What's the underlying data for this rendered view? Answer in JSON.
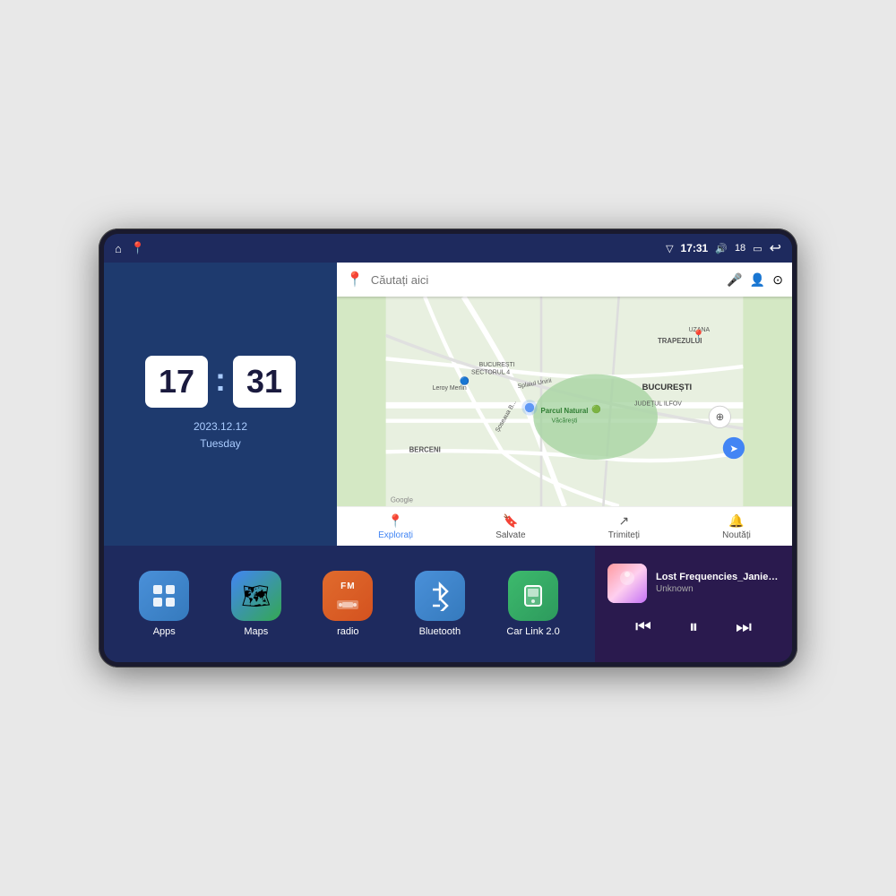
{
  "device": {
    "status_bar": {
      "left_icons": [
        "home",
        "maps-pin"
      ],
      "time": "17:31",
      "signal_icon": "▽",
      "volume_icon": "🔊",
      "battery_level": "18",
      "battery_icon": "▭",
      "back_icon": "↩"
    },
    "clock": {
      "hours": "17",
      "minutes": "31",
      "date": "2023.12.12",
      "day": "Tuesday"
    },
    "map": {
      "search_placeholder": "Căutați aici",
      "locations": [
        "Parcul Natural Văcărești",
        "Leroy Merlin",
        "BUCUREȘTI SECTORUL 4",
        "BUCUREȘTI",
        "JUDEȚUL ILFOV",
        "BERCENI",
        "TRAPEZULUI",
        "UZANA"
      ],
      "bottom_tabs": [
        {
          "label": "Explorați",
          "icon": "📍",
          "active": true
        },
        {
          "label": "Salvate",
          "icon": "🔖",
          "active": false
        },
        {
          "label": "Trimiteți",
          "icon": "↗",
          "active": false
        },
        {
          "label": "Noutăți",
          "icon": "🔔",
          "active": false
        }
      ]
    },
    "apps": [
      {
        "id": "apps",
        "label": "Apps",
        "icon": "⊞",
        "color_class": "icon-apps"
      },
      {
        "id": "maps",
        "label": "Maps",
        "icon": "🗺",
        "color_class": "icon-maps"
      },
      {
        "id": "radio",
        "label": "radio",
        "icon": "📻",
        "color_class": "icon-radio"
      },
      {
        "id": "bluetooth",
        "label": "Bluetooth",
        "icon": "₿",
        "color_class": "icon-bluetooth"
      },
      {
        "id": "carlink",
        "label": "Car Link 2.0",
        "icon": "📱",
        "color_class": "icon-carlink"
      }
    ],
    "music": {
      "title": "Lost Frequencies_Janieck Devy-...",
      "artist": "Unknown",
      "controls": {
        "prev": "⏮",
        "play_pause": "⏸",
        "next": "⏭"
      }
    }
  }
}
